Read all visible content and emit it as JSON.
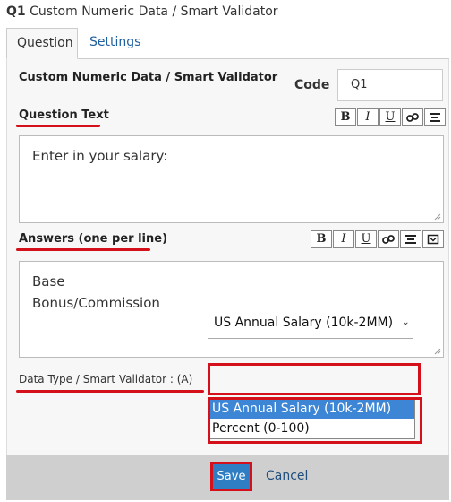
{
  "header": {
    "question_id": "Q1",
    "title": "Custom Numeric Data / Smart Validator"
  },
  "tabs": [
    {
      "label": "Question"
    },
    {
      "label": "Settings"
    }
  ],
  "form": {
    "section_title": "Custom Numeric Data / Smart Validator",
    "code_label": "Code",
    "code_value": "Q1",
    "question_text_label": "Question Text",
    "question_text_value": "Enter in your salary:",
    "answers_label": "Answers (one per line)",
    "answers_lines": [
      "Base",
      "Bonus/Commission"
    ],
    "data_type_label": "Data Type / Smart Validator : (A)",
    "data_type_selected": "US Annual Salary (10k-2MM)",
    "data_type_options": [
      "US Annual Salary (10k-2MM)",
      "Percent (0-100)"
    ]
  },
  "toolbar": {
    "bold": "B",
    "italic": "I",
    "underline": "U"
  },
  "footer": {
    "save_label": "Save",
    "cancel_label": "Cancel"
  },
  "colors": {
    "accent": "#2f7ec4",
    "highlight": "#d4101a",
    "selected": "#3d86d6"
  }
}
